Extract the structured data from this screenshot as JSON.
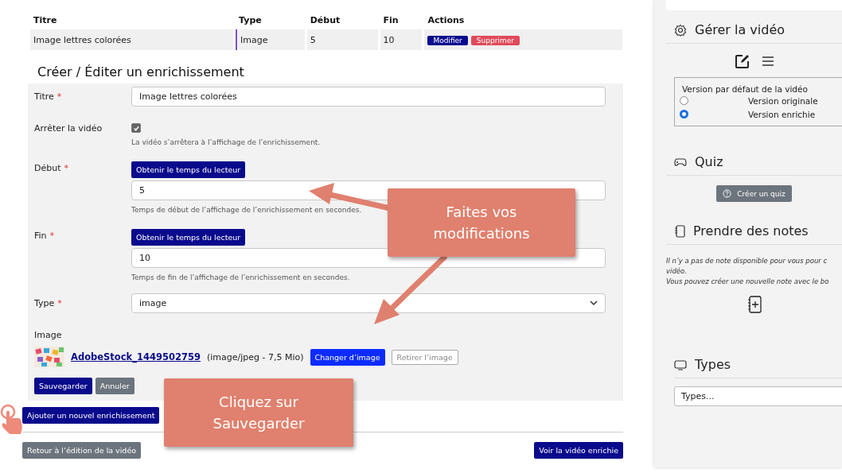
{
  "table": {
    "columns": [
      "Titre",
      "Type",
      "Début",
      "Fin",
      "Actions"
    ],
    "rows": [
      {
        "cells": [
          "Image lettres colorées",
          "Image",
          "5",
          "10"
        ],
        "actions": [
          {
            "label": "Modifier",
            "kind": "edit"
          },
          {
            "label": "Supprimer",
            "kind": "delete"
          }
        ]
      }
    ]
  },
  "form": {
    "title": "Créer / Éditer un enrichissement",
    "fields": [
      {
        "kind": "text",
        "label": "Titre",
        "required_mark": "*",
        "value": "Image lettres colorées"
      },
      {
        "kind": "checkbox",
        "label": "Arrêter la vidéo",
        "checked": true,
        "help": "La vidéo s’arrêtera à l’affichage de l’enrichissement."
      },
      {
        "kind": "time",
        "label": "Début",
        "required_mark": "*",
        "button": "Obtenir le temps du lecteur",
        "value": "5",
        "help": "Temps de début de l’affichage de l’enrichissement en secondes."
      },
      {
        "kind": "time",
        "label": "Fin",
        "required_mark": "*",
        "button": "Obtenir le temps du lecteur",
        "value": "10",
        "help": "Temps de fin de l’affichage de l’enrichissement en secondes."
      },
      {
        "kind": "select",
        "label": "Type",
        "required_mark": "*",
        "value": "image"
      },
      {
        "label": "Image",
        "file": "AdobeStock_1449502759",
        "info": "(image/jpeg - 7,5 Mio)",
        "change": "Changer d’image",
        "remove": "Retirer l’image"
      }
    ],
    "buttons": [
      {
        "label": "Sauvegarder",
        "kind": "primary"
      },
      {
        "label": "Annuler",
        "kind": "secondary"
      }
    ]
  },
  "add_button": "Ajouter un nouvel enrichissement",
  "footer": {
    "back": "Retour à l’édition de la vidéo",
    "view": "Voir la vidéo enrichie"
  },
  "callouts": [
    {
      "text": "Faites vos modifications"
    },
    {
      "text": "Cliquez sur Sauvegarder"
    }
  ],
  "sidebar": [
    {
      "kind": "manage",
      "title": "Gérer la vidéo",
      "legend": "Version par défaut de la vidéo",
      "options": [
        {
          "label": "Version originale",
          "selected": false
        },
        {
          "label": "Version enrichie",
          "selected": true
        }
      ]
    },
    {
      "kind": "quiz",
      "title": "Quiz",
      "button": "Créer un quiz"
    },
    {
      "kind": "notes",
      "title": "Prendre des notes",
      "lines": [
        "Il n’y a pas de note disponible pour vous pour c",
        "vidéo.",
        "Vous pouvez créer une nouvelle note avec le bo"
      ]
    },
    {
      "kind": "types",
      "title": "Types",
      "placeholder": "Types..."
    }
  ]
}
